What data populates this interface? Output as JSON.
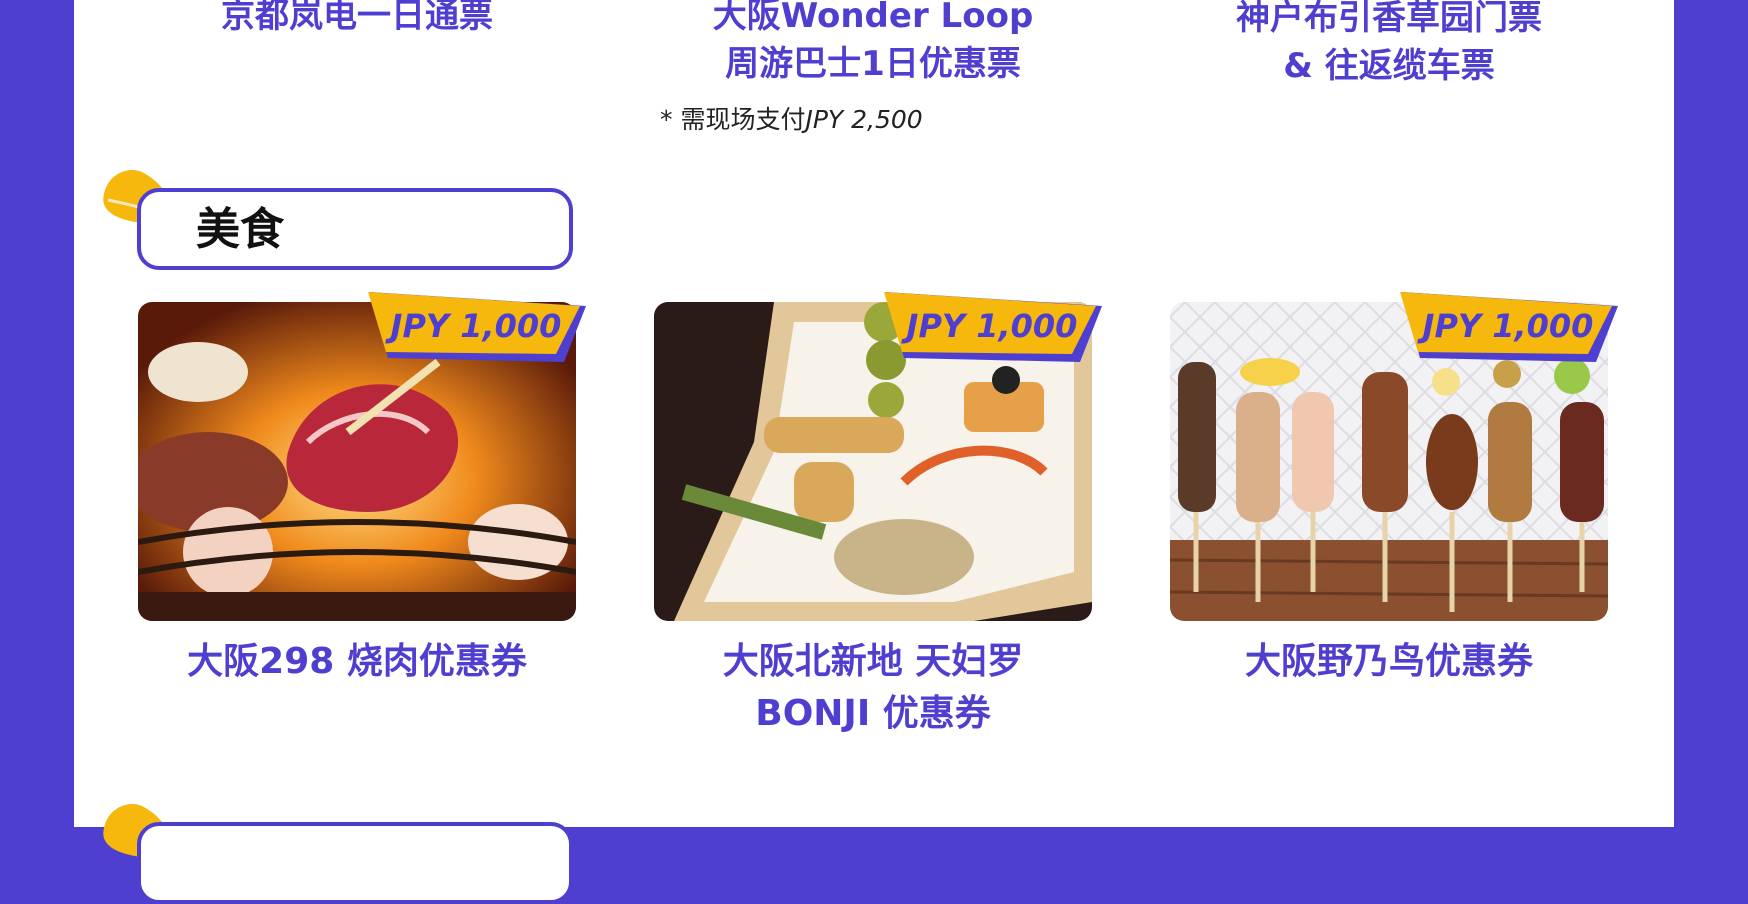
{
  "passes": [
    {
      "lines": [
        "京都岚电一日通票"
      ]
    },
    {
      "lines": [
        "大阪Wonder Loop",
        "周游巴士1日优惠票"
      ]
    },
    {
      "lines": [
        "神户布引香草园门票",
        "& 往返缆车票"
      ]
    }
  ],
  "note": {
    "prefix": "* 需现场支付",
    "amount": "JPY 2,500"
  },
  "section": {
    "title": "美食"
  },
  "food_cards": [
    {
      "price": "JPY 1,000",
      "title_lines": [
        "大阪298 烧肉优惠券"
      ],
      "image": "yakiniku-grill-photo"
    },
    {
      "price": "JPY 1,000",
      "title_lines": [
        "大阪北新地 天妇罗",
        "BONJI 优惠券"
      ],
      "image": "tempura-platter-photo"
    },
    {
      "price": "JPY 1,000",
      "title_lines": [
        "大阪野乃鸟优惠券"
      ],
      "image": "yakitori-skewers-photo"
    }
  ],
  "colors": {
    "brand": "#4f3fd0",
    "accent": "#f6b80d",
    "panel": "#ffffff"
  }
}
